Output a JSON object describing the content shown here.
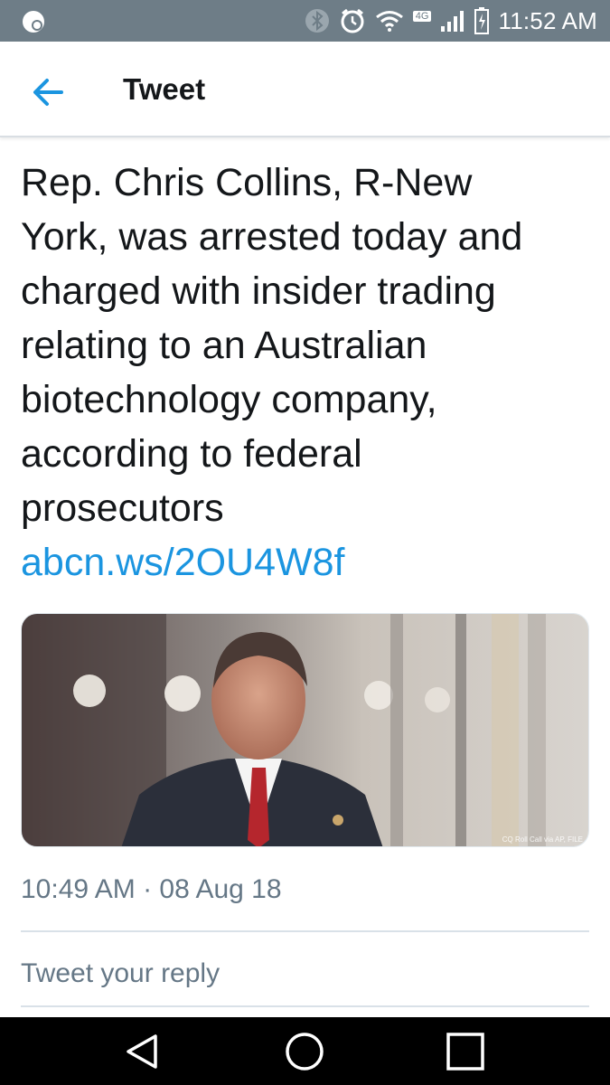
{
  "status_bar": {
    "time": "11:52 AM",
    "network_label": "4G",
    "icons": [
      "notification-app-icon",
      "bluetooth-icon",
      "alarm-icon",
      "wifi-icon",
      "signal-icon",
      "battery-icon"
    ]
  },
  "header": {
    "title": "Tweet",
    "back_icon": "arrow-left-icon",
    "accent_color": "#1b95e0"
  },
  "tweet": {
    "text_lines": [
      "Rep. Chris Collins, R-New",
      "York, was arrested today and",
      "charged with insider trading",
      "relating to an Australian",
      "biotechnology company,",
      "according to federal",
      "prosecutors"
    ],
    "link": "abcn.ws/2OU4W8f",
    "photo_credit": "CQ Roll Call via AP, FILE",
    "timestamp": "10:49 AM · 08 Aug 18"
  },
  "reply": {
    "placeholder": "Tweet your reply"
  },
  "nav_bar": {
    "icons": [
      "back-triangle-icon",
      "home-circle-icon",
      "recents-square-icon"
    ]
  }
}
